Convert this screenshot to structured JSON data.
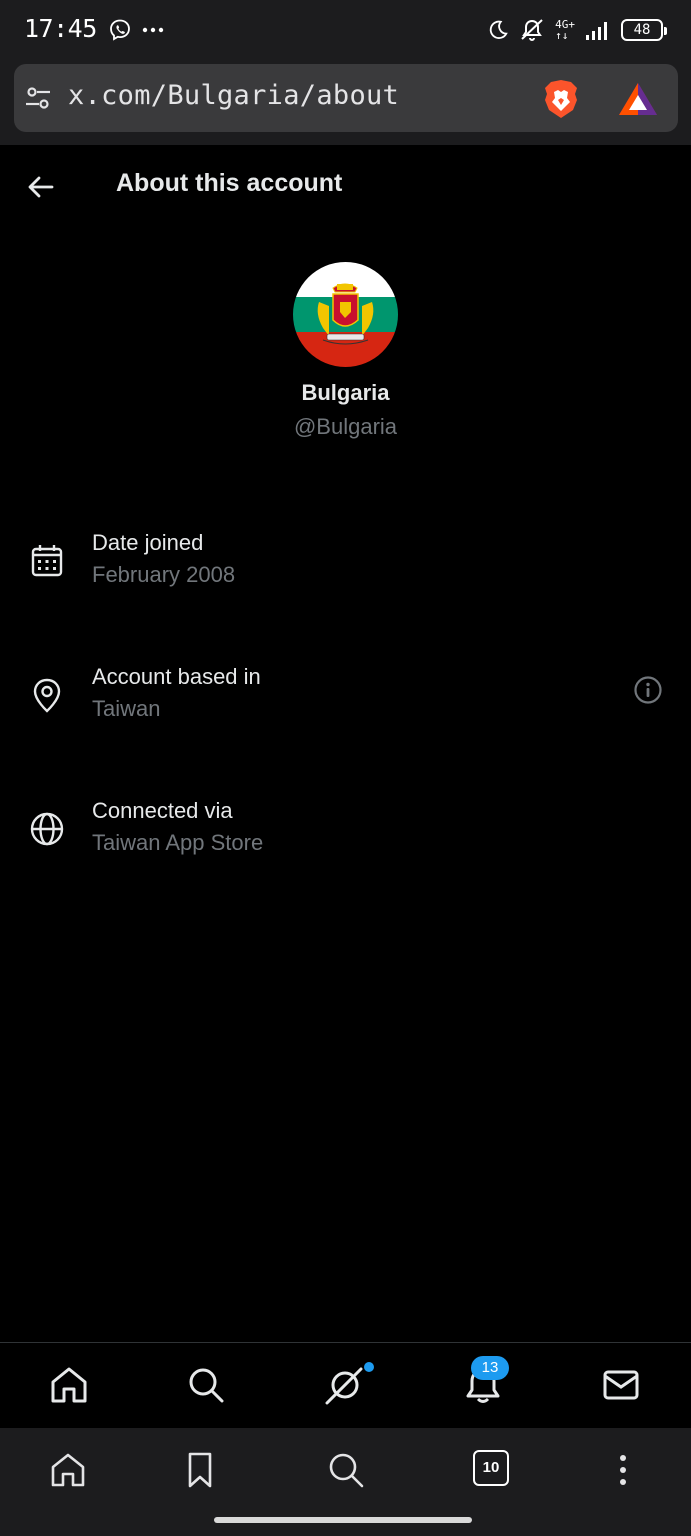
{
  "status_bar": {
    "time": "17:45",
    "network": "4G+",
    "battery": "48"
  },
  "browser": {
    "url": "x.com/Bulgaria/about",
    "tab_count": "10"
  },
  "header": {
    "title": "About this account"
  },
  "profile": {
    "display_name": "Bulgaria",
    "handle": "@Bulgaria"
  },
  "info": {
    "date_joined": {
      "label": "Date joined",
      "value": "February 2008",
      "icon": "calendar-icon"
    },
    "account_based_in": {
      "label": "Account based in",
      "value": "Taiwan",
      "icon": "location-pin-icon"
    },
    "connected_via": {
      "label": "Connected via",
      "value": "Taiwan App Store",
      "icon": "globe-icon"
    }
  },
  "x_nav": {
    "notifications_count": "13"
  },
  "colors": {
    "background": "#000000",
    "text_primary": "#e7e9ea",
    "text_secondary": "#71767b",
    "accent": "#1d9bf0",
    "browser_chrome": "#1c1c1e",
    "brave_orange": "#fb542b"
  }
}
